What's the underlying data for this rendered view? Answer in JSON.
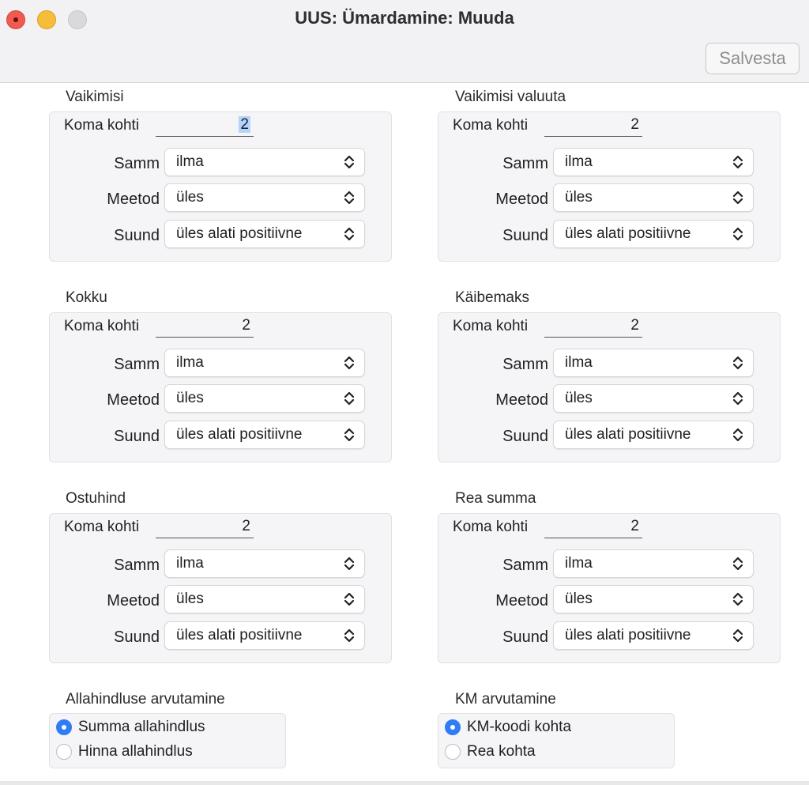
{
  "window": {
    "title": "UUS: Ümardamine: Muuda",
    "save_label": "Salvesta"
  },
  "labels": {
    "koma": "Koma kohti",
    "samm": "Samm",
    "meetod": "Meetod",
    "suund": "Suund"
  },
  "groups": [
    {
      "title": "Vaikimisi",
      "koma": "2",
      "samm": "ilma",
      "meetod": "üles",
      "suund": "üles alati positiivne"
    },
    {
      "title": "Vaikimisi valuuta",
      "koma": "2",
      "samm": "ilma",
      "meetod": "üles",
      "suund": "üles alati positiivne"
    },
    {
      "title": "Kokku",
      "koma": "2",
      "samm": "ilma",
      "meetod": "üles",
      "suund": "üles alati positiivne"
    },
    {
      "title": "Käibemaks",
      "koma": "2",
      "samm": "ilma",
      "meetod": "üles",
      "suund": "üles alati positiivne"
    },
    {
      "title": "Ostuhind",
      "koma": "2",
      "samm": "ilma",
      "meetod": "üles",
      "suund": "üles alati positiivne"
    },
    {
      "title": "Rea summa",
      "koma": "2",
      "samm": "ilma",
      "meetod": "üles",
      "suund": "üles alati positiivne"
    }
  ],
  "discount": {
    "title": "Allahindluse arvutamine",
    "options": [
      {
        "label": "Summa allahindlus",
        "selected": true
      },
      {
        "label": "Hinna allahindlus",
        "selected": false
      }
    ]
  },
  "vat": {
    "title": "KM arvutamine",
    "options": [
      {
        "label": "KM-koodi kohta",
        "selected": true
      },
      {
        "label": "Rea kohta",
        "selected": false
      }
    ]
  },
  "colors": {
    "accent": "#2f7cf6",
    "close": "#ee5b52",
    "minimize": "#f5bd3a",
    "selection": "#b3d4fc"
  }
}
